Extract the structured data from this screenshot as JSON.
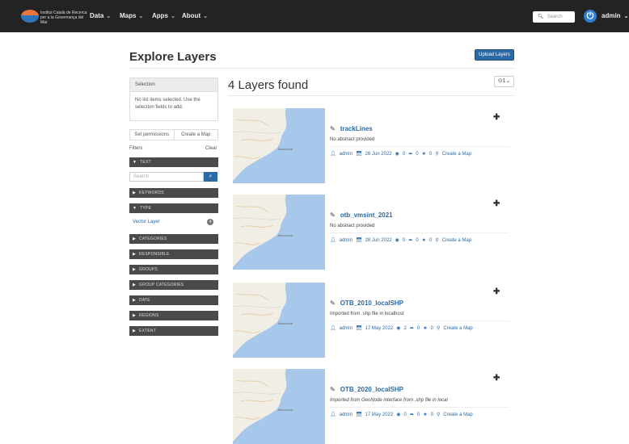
{
  "nav": {
    "brand_line1": "Institut Català de Recerca",
    "brand_line2": "per a la Governança del Mar",
    "items": [
      "Data",
      "Maps",
      "Apps",
      "About"
    ],
    "search_placeholder": "Search",
    "user": "admin"
  },
  "page": {
    "title": "Explore Layers",
    "upload_label": "Upload Layers"
  },
  "selection": {
    "heading": "Selection",
    "message": "No list items selected. Use the selection fields to add.",
    "tabs": [
      "Set permissions",
      "Create a Map"
    ]
  },
  "filters": {
    "label": "Filters",
    "clear_label": "Clear",
    "search_placeholder": "Search",
    "sections": [
      "TEXT",
      "KEYWORDS",
      "TYPE",
      "CATEGORIES",
      "RESPONSIBLE",
      "GROUPS",
      "GROUP CATEGORIES",
      "DATE",
      "REGIONS",
      "EXTENT"
    ],
    "type_value": "Vector Layer",
    "type_count": "4"
  },
  "results": {
    "count_label": "4 Layers found",
    "sort_label": "⊙1⌄",
    "layers": [
      {
        "title": "trackLines",
        "abstract": "No abstract provided",
        "owner": "admin",
        "date": "28 Jun 2022",
        "views": "0",
        "shares": "0",
        "rating": "0",
        "action": "Create a Map"
      },
      {
        "title": "otb_vmsint_2021",
        "abstract": "No abstract provided",
        "owner": "admin",
        "date": "28 Jun 2022",
        "views": "0",
        "shares": "0",
        "rating": "0",
        "action": "Create a Map"
      },
      {
        "title": "OTB_2010_localSHP",
        "abstract": "Imported from .shp file in localhost",
        "owner": "admin",
        "date": "17 May 2022",
        "views": "2",
        "shares": "0",
        "rating": "0",
        "action": "Create a Map"
      },
      {
        "title": "OTB_2020_localSHP",
        "abstract": "Imported from GeoNode interface from .shp file in local",
        "owner": "admin",
        "date": "17 May 2022",
        "views": "0",
        "shares": "0",
        "rating": "0",
        "action": "Create a Map"
      }
    ]
  },
  "map_labels": [
    "Barcelona",
    "Barcelona",
    "Barcelona",
    "Barcelona"
  ],
  "colors": {
    "navbar": "#232323",
    "accent": "#2c6aa6",
    "filter_bar": "#4a4a4a",
    "sea": "#a7c8ea",
    "land": "#f1eee6"
  }
}
